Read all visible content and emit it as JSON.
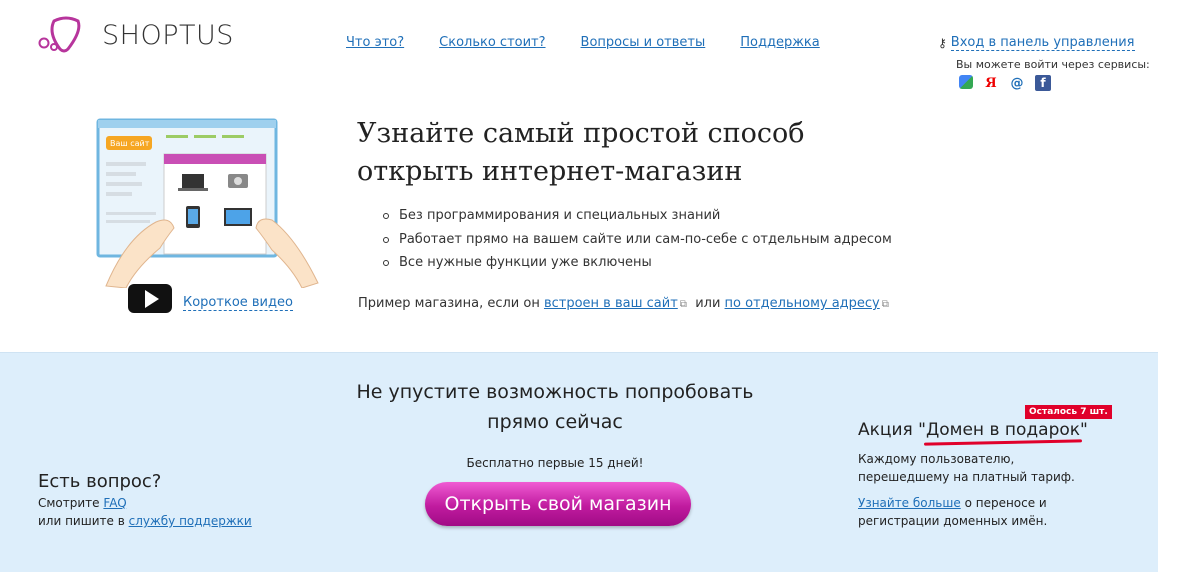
{
  "brand": {
    "name": "SHOPTUS"
  },
  "nav": {
    "items": [
      "Что это?",
      "Сколько стоит?",
      "Вопросы и ответы",
      "Поддержка"
    ]
  },
  "login": {
    "label": "Вход в панель управления",
    "services_label": "Вы можете войти через сервисы:",
    "services": [
      "google-icon",
      "yandex-icon",
      "mailru-icon",
      "facebook-icon"
    ]
  },
  "hero": {
    "illustration_badge": "Ваш сайт",
    "video_label": "Короткое видео",
    "title_line1": "Узнайте самый простой способ",
    "title_line2": "открыть интернет-магазин",
    "bullets": [
      "Без программирования и специальных знаний",
      "Работает прямо на вашем сайте или сам-по-себе с отдельным адресом",
      "Все нужные функции уже включены"
    ],
    "example_prefix": "Пример магазина, если он",
    "example_link1": "встроен в ваш сайт",
    "example_or": "или",
    "example_link2": "по отдельному адресу"
  },
  "cta": {
    "title_line1": "Не упустите возможность попробовать",
    "title_line2": "прямо сейчас",
    "free_note": "Бесплатно первые 15 дней!",
    "button": "Открыть свой магазин"
  },
  "question": {
    "title": "Есть вопрос?",
    "line1_prefix": "Смотрите",
    "faq_link": "FAQ",
    "line2_prefix": "или пишите в",
    "support_link": "службу поддержки"
  },
  "promo": {
    "badge": "Осталось 7 шт.",
    "title_prefix": "Акция \"",
    "title_highlight": "Домен в подарок",
    "title_suffix": "\"",
    "text": "Каждому пользователю, перешедшему на платный тариф.",
    "more_link": "Узнайте больше",
    "more_text": "о переносе и регистрации доменных имён."
  },
  "colors": {
    "accent": "#1f6fb8",
    "button": "#c01b9f",
    "band": "#ddeefb",
    "badge": "#e0002a"
  }
}
